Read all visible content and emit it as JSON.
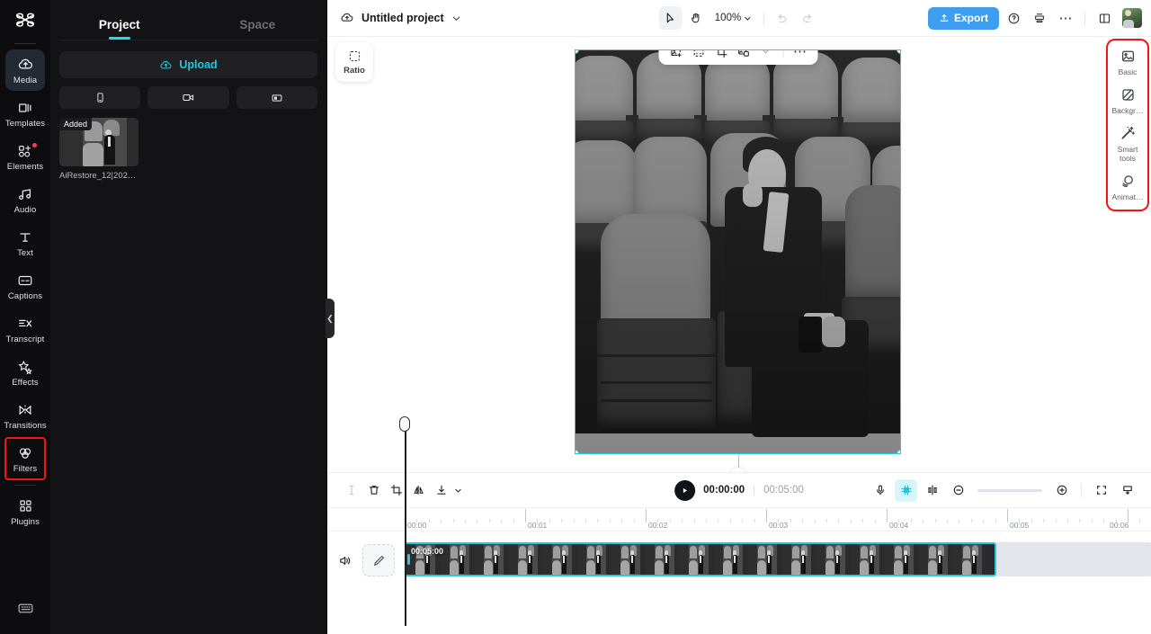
{
  "app": {
    "name": "CapCut Video Editor",
    "accent": "#2fc5d6",
    "export_color": "#3d9ef0",
    "highlight_color": "#f71313"
  },
  "rail": {
    "logo_icon": "capcut-logo-icon",
    "items": [
      {
        "label": "Media",
        "icon": "cloud-media-icon",
        "active": true,
        "badge": false,
        "highlight": false
      },
      {
        "label": "Templates",
        "icon": "templates-icon",
        "active": false,
        "badge": false,
        "highlight": false
      },
      {
        "label": "Elements",
        "icon": "elements-icon",
        "active": false,
        "badge": true,
        "highlight": false
      },
      {
        "label": "Audio",
        "icon": "audio-note-icon",
        "active": false,
        "badge": false,
        "highlight": false
      },
      {
        "label": "Text",
        "icon": "text-icon",
        "active": false,
        "badge": false,
        "highlight": false
      },
      {
        "label": "Captions",
        "icon": "captions-icon",
        "active": false,
        "badge": false,
        "highlight": false
      },
      {
        "label": "Transcript",
        "icon": "transcript-icon",
        "active": false,
        "badge": false,
        "highlight": false
      },
      {
        "label": "Effects",
        "icon": "effects-sparkle-icon",
        "active": false,
        "badge": false,
        "highlight": false
      },
      {
        "label": "Transitions",
        "icon": "transitions-icon",
        "active": false,
        "badge": false,
        "highlight": false
      },
      {
        "label": "Filters",
        "icon": "filters-circles-icon",
        "active": false,
        "badge": false,
        "highlight": true
      },
      {
        "label": "Plugins",
        "icon": "plugins-grid-icon",
        "active": false,
        "badge": false,
        "highlight": false
      }
    ],
    "bottom_icon": "keyboard-shortcuts-icon"
  },
  "panel": {
    "tabs": [
      {
        "label": "Project",
        "active": true
      },
      {
        "label": "Space",
        "active": false
      }
    ],
    "upload": {
      "label": "Upload",
      "icon": "cloud-upload-icon"
    },
    "quick_actions": [
      {
        "icon": "phone-import-icon",
        "name": "import-from-phone"
      },
      {
        "icon": "camera-record-icon",
        "name": "record-video"
      },
      {
        "icon": "screen-record-icon",
        "name": "record-screen"
      }
    ],
    "media_items": [
      {
        "badge": "Added",
        "name": "AiRestore_12|202…"
      }
    ],
    "collapse_handle_icon": "chevron-left-icon"
  },
  "topbar": {
    "cloud_icon": "cloud-sync-icon",
    "project_name": "Untitled project",
    "project_caret": "chevron-down-icon",
    "tools": [
      {
        "icon": "cursor-select-icon",
        "name": "select-tool",
        "selected": true
      },
      {
        "icon": "hand-pan-icon",
        "name": "hand-tool",
        "selected": false
      }
    ],
    "zoom_level": "100%",
    "undo_icon": "undo-icon",
    "redo_icon": "redo-icon",
    "export_label": "Export",
    "export_icon": "export-upload-icon",
    "help_icon": "help-question-icon",
    "print_icon": "layers-stack-icon",
    "more_icon": "more-horizontal-icon",
    "layout_icon": "panel-layout-icon",
    "avatar_name": "user-avatar"
  },
  "stage": {
    "ratio_button": {
      "label": "Ratio",
      "icon": "aspect-ratio-icon"
    },
    "float_tools": [
      {
        "icon": "add-image-icon",
        "name": "replace-media"
      },
      {
        "icon": "keyframe-icon",
        "name": "auto-reframe"
      },
      {
        "icon": "crop-icon",
        "name": "crop"
      },
      {
        "icon": "remove-bg-icon",
        "name": "remove-background"
      },
      {
        "icon": "chevron-down-icon",
        "name": "remove-background-options"
      },
      {
        "icon": "more-horizontal-icon",
        "name": "more-options"
      }
    ],
    "rotate_handle_icon": "rotate-icon",
    "selection_handles": [
      "top-left",
      "top-right",
      "bottom-left",
      "bottom-right"
    ]
  },
  "right_tools": {
    "items": [
      {
        "label": "Basic",
        "icon": "image-basic-icon"
      },
      {
        "label": "Backgr…",
        "icon": "background-icon"
      },
      {
        "label": "Smart tools",
        "icon": "magic-wand-icon"
      },
      {
        "label": "Animat…",
        "icon": "animation-icon"
      }
    ]
  },
  "timeline": {
    "left_tools": [
      {
        "icon": "split-cursor-icon",
        "name": "split-tool",
        "disabled": true
      },
      {
        "icon": "delete-trash-icon",
        "name": "delete-clip",
        "disabled": false
      },
      {
        "icon": "crop-icon",
        "name": "crop-clip",
        "disabled": false
      },
      {
        "icon": "mirror-flip-icon",
        "name": "mirror-clip",
        "disabled": false
      },
      {
        "icon": "download-icon",
        "name": "download-clip",
        "disabled": false
      },
      {
        "icon": "chevron-down-icon",
        "name": "download-options",
        "disabled": false
      }
    ],
    "play_icon": "play-icon",
    "current_time": "00:00:00",
    "total_time": "00:05:00",
    "right_tools": [
      {
        "icon": "microphone-icon",
        "name": "voiceover",
        "active": false
      },
      {
        "icon": "ai-chip-icon",
        "name": "ai-assistant",
        "active": true
      },
      {
        "icon": "split-clip-icon",
        "name": "split",
        "active": false
      },
      {
        "icon": "zoom-out-icon",
        "name": "zoom-out-timeline",
        "active": false
      },
      {
        "icon": "zoom-in-icon",
        "name": "zoom-in-timeline",
        "active": false
      },
      {
        "icon": "fit-timeline-icon",
        "name": "fit-to-timeline",
        "active": false
      },
      {
        "icon": "track-height-icon",
        "name": "track-height",
        "active": false
      }
    ],
    "ruler_labels": [
      "00:00",
      "00:01",
      "00:02",
      "00:03",
      "00:04",
      "00:05",
      "00:06"
    ],
    "track": {
      "mute_icon": "speaker-icon",
      "edit_icon": "pencil-edit-icon",
      "clip_duration": "00:05:00"
    }
  }
}
